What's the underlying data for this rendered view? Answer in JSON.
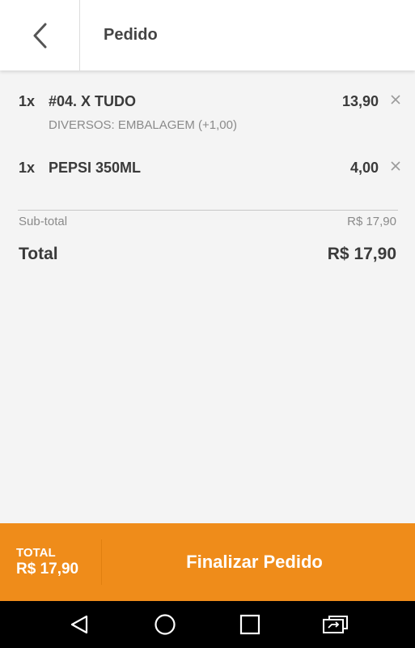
{
  "header": {
    "title": "Pedido",
    "back_icon": "chevron-left-icon"
  },
  "order": {
    "items": [
      {
        "qty": "1x",
        "name": "#04. X TUDO",
        "price": "13,90",
        "extra": "DIVERSOS: EMBALAGEM (+1,00)"
      },
      {
        "qty": "1x",
        "name": "PEPSI 350ML",
        "price": "4,00",
        "extra": ""
      }
    ],
    "subtotal_label": "Sub-total",
    "subtotal_value": "R$ 17,90",
    "total_label": "Total",
    "total_value": "R$ 17,90"
  },
  "footer": {
    "total_label": "TOTAL",
    "total_value": "R$ 17,90",
    "finalize_label": "Finalizar Pedido"
  },
  "navbar": {
    "icons": [
      "back-triangle-icon",
      "home-circle-icon",
      "recents-square-icon",
      "switch-app-icon"
    ]
  },
  "colors": {
    "accent": "#ef8c1a",
    "background": "#f4f4f4",
    "header_bg": "#ffffff",
    "nav_bg": "#000000"
  }
}
